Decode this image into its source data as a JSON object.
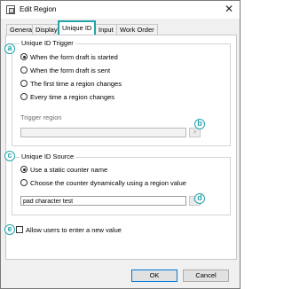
{
  "window": {
    "title": "Edit Region",
    "close_glyph": "✕"
  },
  "tabs": [
    {
      "label": "General"
    },
    {
      "label": "Display"
    },
    {
      "label": "Unique ID"
    },
    {
      "label": "Input"
    },
    {
      "label": "Work Order"
    }
  ],
  "markers": {
    "a": "a",
    "b": "b",
    "c": "c",
    "d": "d",
    "e": "e"
  },
  "trigger": {
    "title": "Unique ID Trigger",
    "options": [
      {
        "label": "When the form draft is started",
        "checked": true
      },
      {
        "label": "When the form draft is sent",
        "checked": false
      },
      {
        "label": "The first time a region changes",
        "checked": false
      },
      {
        "label": "Every time a region changes",
        "checked": false
      }
    ],
    "region_label": "Trigger region",
    "region_value": "",
    "picker_glyph": ">"
  },
  "source": {
    "title": "Unique ID Source",
    "options": [
      {
        "label": "Use a static counter name",
        "checked": true
      },
      {
        "label": "Choose the counter dynamically using a region value",
        "checked": false
      }
    ],
    "counter_value": "pad character test",
    "picker_glyph": ">"
  },
  "allow_new": {
    "label": "Allow users to enter a new value",
    "checked": false
  },
  "buttons": {
    "ok": "OK",
    "cancel": "Cancel"
  },
  "colors": {
    "accent": "#23a3a8",
    "default_button_border": "#0078d7"
  }
}
